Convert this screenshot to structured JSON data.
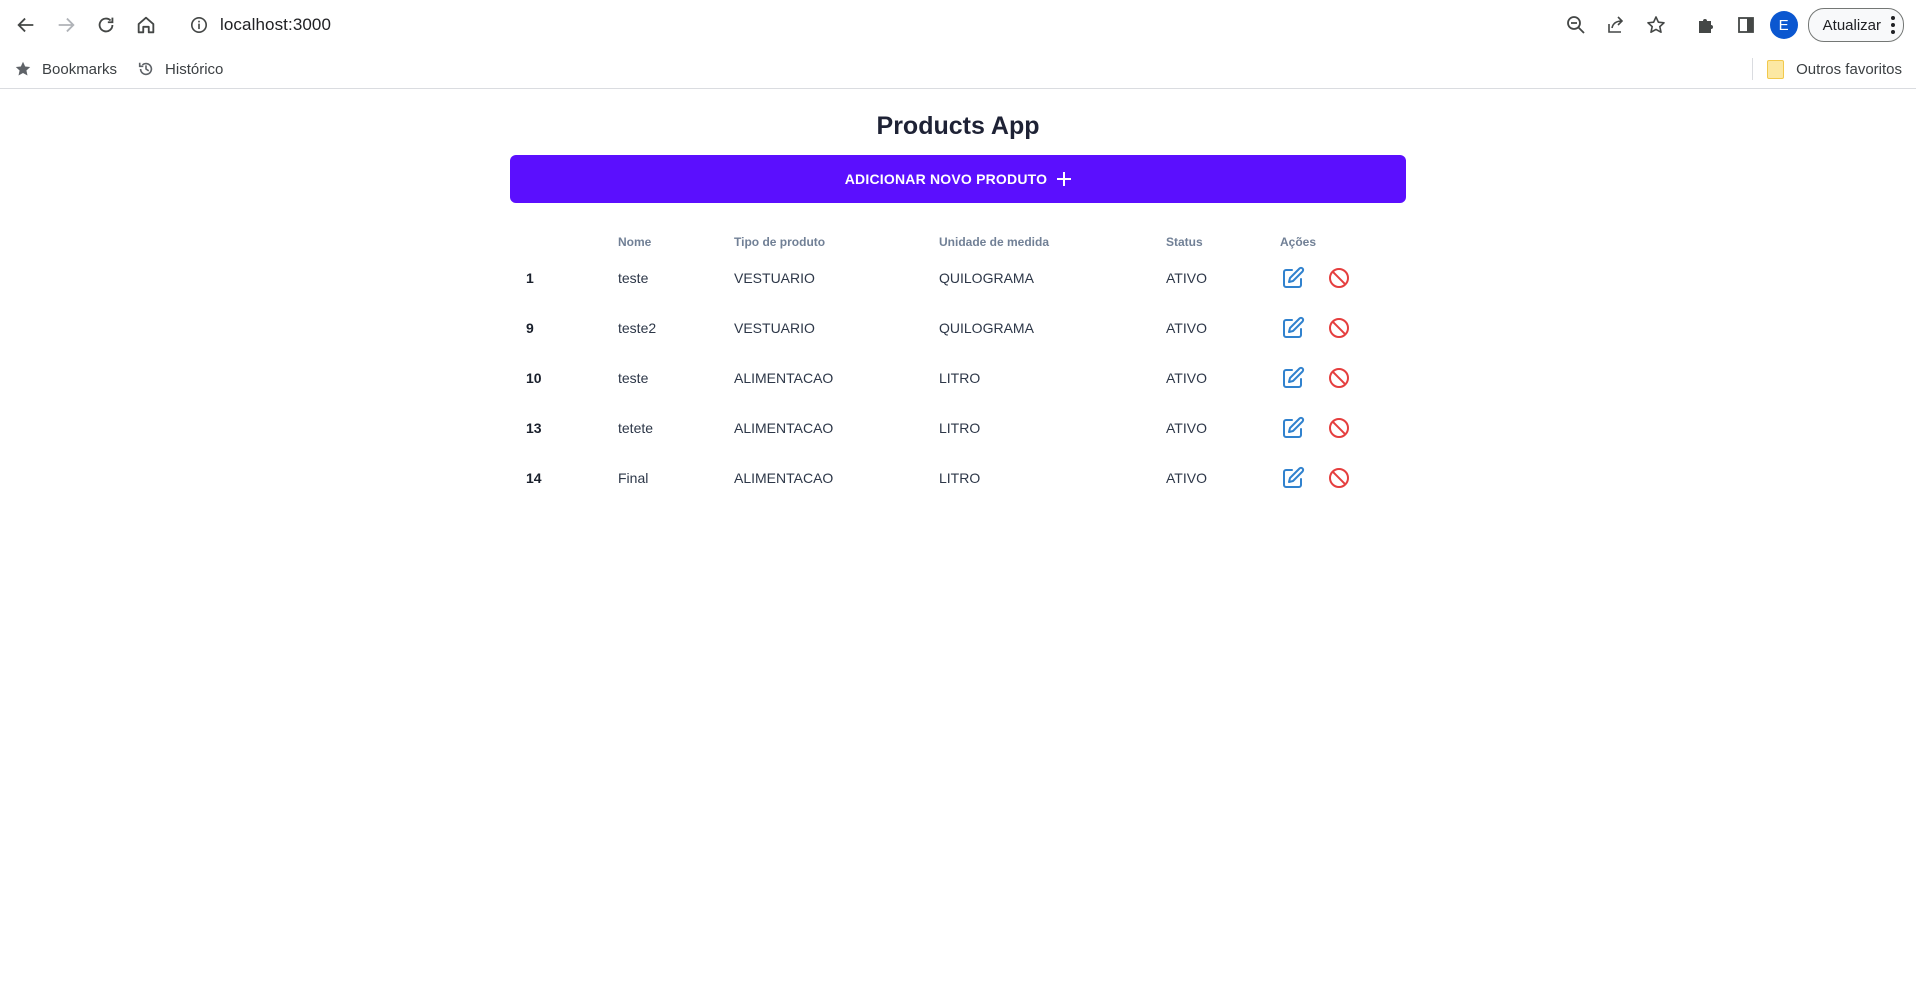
{
  "browser": {
    "url": "localhost:3000",
    "update_label": "Atualizar",
    "profile_initial": "E",
    "bookmarks": [
      {
        "label": "Bookmarks",
        "icon": "star-icon"
      },
      {
        "label": "Histórico",
        "icon": "history-icon"
      }
    ],
    "other_bookmarks": "Outros favoritos"
  },
  "app": {
    "title": "Products App",
    "add_button_label": "ADICIONAR NOVO PRODUTO",
    "accent_color": "#5b0ffe",
    "edit_icon_color": "#3182ce",
    "delete_icon_color": "#e53e3e"
  },
  "table": {
    "headers": [
      "",
      "Nome",
      "Tipo de produto",
      "Unidade de medida",
      "Status",
      "Ações"
    ],
    "rows": [
      {
        "id": "1",
        "nome": "teste",
        "tipo": "VESTUARIO",
        "unidade": "QUILOGRAMA",
        "status": "ATIVO"
      },
      {
        "id": "9",
        "nome": "teste2",
        "tipo": "VESTUARIO",
        "unidade": "QUILOGRAMA",
        "status": "ATIVO"
      },
      {
        "id": "10",
        "nome": "teste",
        "tipo": "ALIMENTACAO",
        "unidade": "LITRO",
        "status": "ATIVO"
      },
      {
        "id": "13",
        "nome": "tetete",
        "tipo": "ALIMENTACAO",
        "unidade": "LITRO",
        "status": "ATIVO"
      },
      {
        "id": "14",
        "nome": "Final",
        "tipo": "ALIMENTACAO",
        "unidade": "LITRO",
        "status": "ATIVO"
      }
    ]
  }
}
